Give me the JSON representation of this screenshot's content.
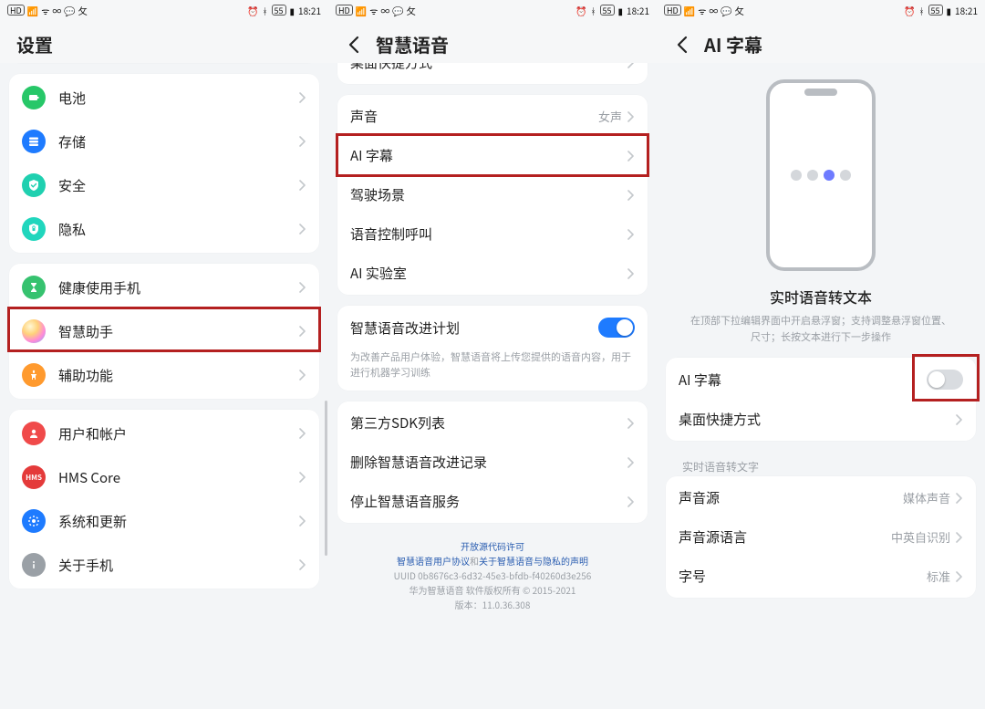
{
  "status": {
    "time": "18:21",
    "battery_text": "55",
    "alarm": true
  },
  "panel1": {
    "title": "设置",
    "groups": [
      {
        "rows": [
          {
            "icon": "battery",
            "color": "#27c768",
            "label": "电池"
          },
          {
            "icon": "storage",
            "color": "#1e7bff",
            "label": "存储"
          },
          {
            "icon": "shield",
            "color": "#1fd0b0",
            "label": "安全"
          },
          {
            "icon": "privacy",
            "color": "#20d6bd",
            "label": "隐私"
          }
        ]
      },
      {
        "rows": [
          {
            "icon": "hourglass",
            "color": "#36c26f",
            "label": "健康使用手机"
          },
          {
            "icon": "ai-orb",
            "color": "#ffd27a",
            "label": "智慧助手",
            "highlight": true
          },
          {
            "icon": "accessibility",
            "color": "#ff9a2e",
            "label": "辅助功能"
          }
        ]
      },
      {
        "rows": [
          {
            "icon": "user",
            "color": "#f04a4a",
            "label": "用户和帐户"
          },
          {
            "icon": "hms",
            "color": "#e43a3a",
            "label": "HMS Core"
          },
          {
            "icon": "gear",
            "color": "#1e7bff",
            "label": "系统和更新"
          },
          {
            "icon": "info",
            "color": "#9aa0a6",
            "label": "关于手机"
          }
        ]
      }
    ]
  },
  "panel2": {
    "title": "智慧语音",
    "top_row_label": "桌面快捷方式",
    "groups": [
      {
        "rows": [
          {
            "label": "声音",
            "value": "女声"
          },
          {
            "label": "AI 字幕",
            "highlight": true
          },
          {
            "label": "驾驶场景"
          },
          {
            "label": "语音控制呼叫"
          },
          {
            "label": "AI 实验室"
          }
        ]
      },
      {
        "rows": [
          {
            "label": "智慧语音改进计划",
            "toggle_on": true
          }
        ],
        "hint": "为改善产品用户体验，智慧语音将上传您提供的语音内容，用于进行机器学习训练"
      },
      {
        "rows": [
          {
            "label": "第三方SDK列表"
          },
          {
            "label": "删除智慧语音改进记录"
          },
          {
            "label": "停止智慧语音服务"
          }
        ]
      }
    ],
    "footer": {
      "line1": "开放源代码许可",
      "line2a": "智慧语音用户协议",
      "line2_mid": "和",
      "line2b": "关于智慧语音与隐私的声明",
      "uuid": "UUID 0b8676c3-6d32-45e3-bfdb-f40260d3e256",
      "copyright": "华为智慧语音 软件版权所有 © 2015-2021",
      "version": "版本：11.0.36.308"
    }
  },
  "panel3": {
    "title": "AI 字幕",
    "hero_title": "实时语音转文本",
    "hero_desc": "在顶部下拉编辑界面中开启悬浮窗；支持调整悬浮窗位置、尺寸；长按文本进行下一步操作",
    "rows": {
      "ai_subtitle": {
        "label": "AI 字幕",
        "toggle_on": false,
        "highlight": true
      },
      "desktop_shortcut": {
        "label": "桌面快捷方式"
      }
    },
    "section_label": "实时语音转文字",
    "group2": [
      {
        "label": "声音源",
        "value": "媒体声音"
      },
      {
        "label": "声音源语言",
        "value": "中英自识别"
      },
      {
        "label": "字号",
        "value": "标准"
      }
    ]
  }
}
